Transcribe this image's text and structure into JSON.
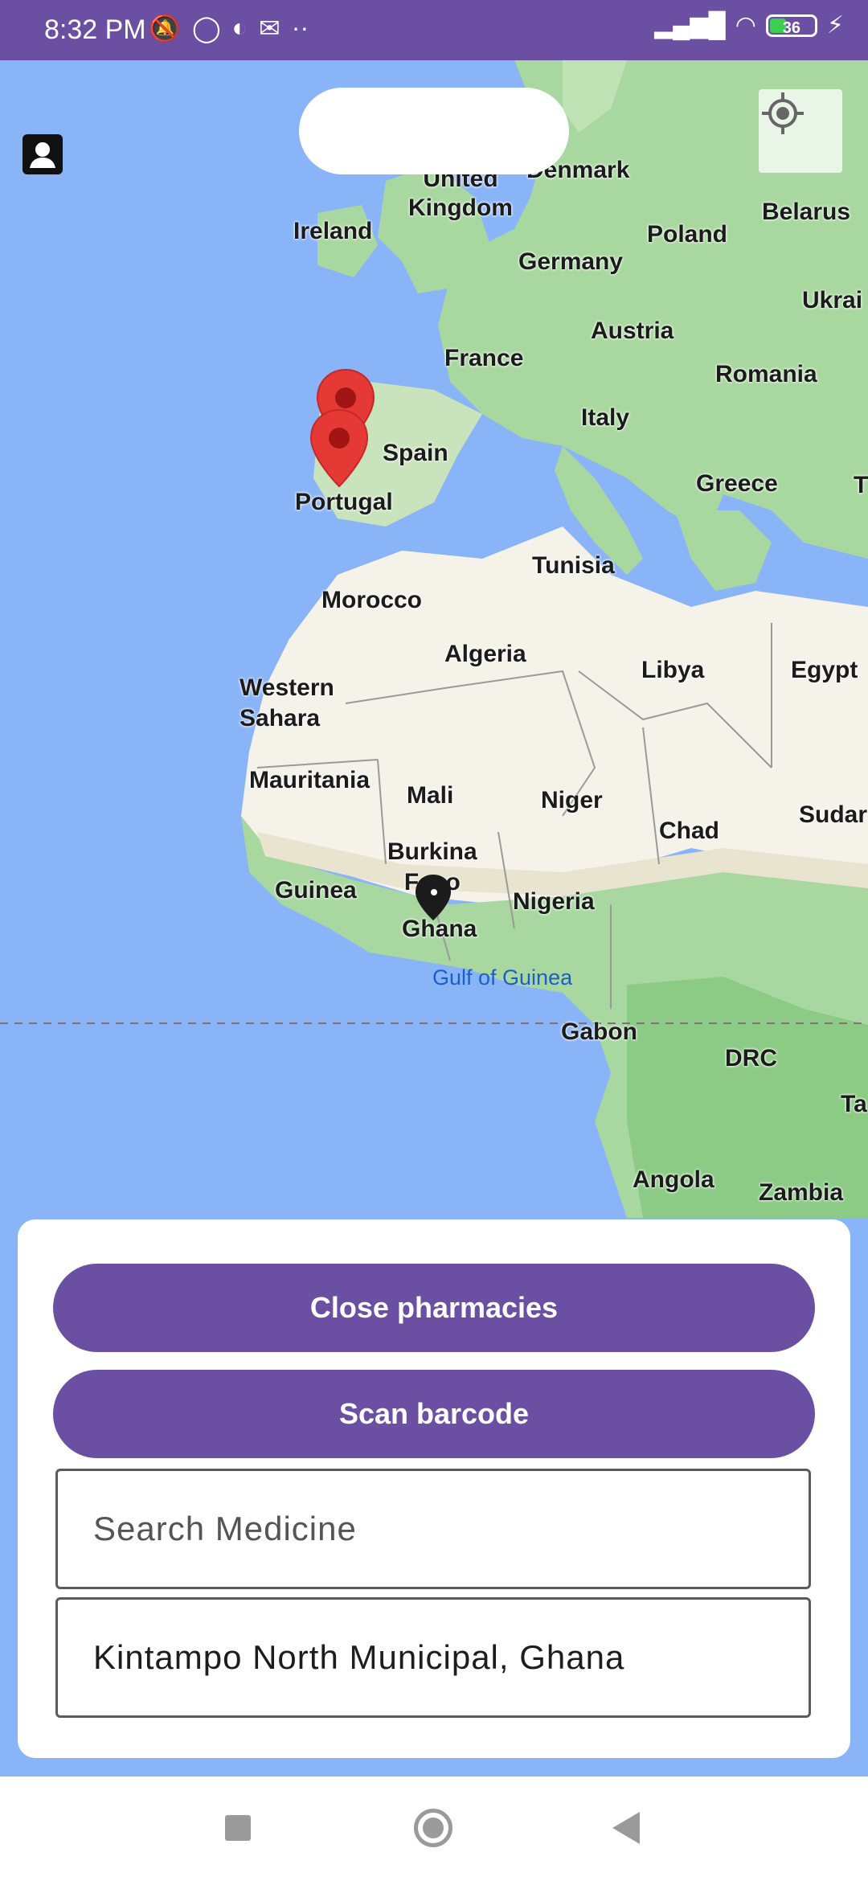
{
  "status_bar": {
    "time": "8:32 PM",
    "battery_level": "36",
    "icons_left": [
      "mute-bell-icon",
      "whatsapp-icon",
      "app-icon",
      "mail-icon",
      "more-dots-icon"
    ],
    "icons_right": [
      "signal-icon",
      "wifi-icon",
      "battery-icon",
      "charging-icon"
    ]
  },
  "map": {
    "labels": {
      "united_kingdom": "United\nKingdom",
      "denmark": "Denmark",
      "ireland": "Ireland",
      "poland": "Poland",
      "belarus": "Belarus",
      "germany": "Germany",
      "ukraine": "Ukrai",
      "austria": "Austria",
      "france": "France",
      "romania": "Romania",
      "italy": "Italy",
      "spain": "Spain",
      "portugal": "Portugal",
      "greece": "Greece",
      "t": "T",
      "tunisia": "Tunisia",
      "morocco": "Morocco",
      "algeria": "Algeria",
      "libya": "Libya",
      "egypt": "Egypt",
      "western_sahara": "Western\nSahara",
      "mauritania": "Mauritania",
      "mali": "Mali",
      "niger": "Niger",
      "sudan": "Sudar",
      "chad": "Chad",
      "burkina_faso": "Burkina\nFaso",
      "guinea": "Guinea",
      "nigeria": "Nigeria",
      "ghana": "Ghana",
      "gulf_of_guinea": "Gulf of Guinea",
      "gabon": "Gabon",
      "drc": "DRC",
      "tanzania": "Ta",
      "angola": "Angola",
      "zambia": "Zambia"
    },
    "markers": [
      "pharmacy-marker",
      "pharmacy-marker",
      "current-location-marker"
    ]
  },
  "panel": {
    "close_pharmacies": "Close pharmacies",
    "scan_barcode": "Scan barcode",
    "search_placeholder": "Search Medicine",
    "location_value": "Kintampo North Municipal, Ghana"
  },
  "colors": {
    "primary": "#6a4fa3",
    "water": "#8ab4f8",
    "land_green": "#a8d8a0",
    "desert": "#f5f2ea",
    "marker_red": "#e53935"
  }
}
